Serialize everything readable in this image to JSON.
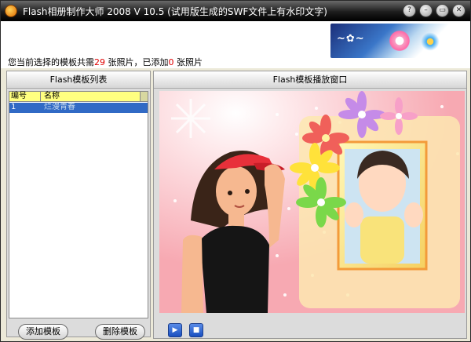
{
  "window": {
    "title": "Flash相册制作大师 2008 V 10.5 (试用版生成的SWF文件上有水印文字)",
    "controls": {
      "help": "?",
      "minimize": "–",
      "maximize": "▭",
      "close": "✕"
    }
  },
  "header": {
    "status_prefix": "您当前选择的模板共需",
    "required_count": "29",
    "status_middle": "张照片，已添加",
    "added_count": "0",
    "status_suffix": "张照片"
  },
  "template_list": {
    "title": "Flash模板列表",
    "columns": [
      "编号",
      "名称"
    ],
    "rows": [
      {
        "id": "1",
        "name": "烂漫青春"
      }
    ],
    "add_button": "添加模板",
    "delete_button": "删除模板"
  },
  "player": {
    "title": "Flash模板播放窗口",
    "play_icon": "play-icon",
    "stop_icon": "stop-icon"
  },
  "colors": {
    "title_bar": "#1c1c1c",
    "selection": "#316ac5",
    "count_red": "#e00000",
    "list_header": "#ffff80"
  }
}
